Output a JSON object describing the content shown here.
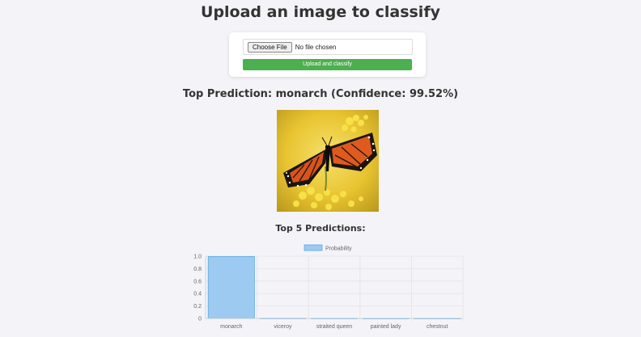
{
  "page": {
    "title": "Upload an image to classify"
  },
  "upload": {
    "choose_label": "Choose File",
    "file_status": "No file chosen",
    "submit_label": "Upload and classify",
    "submit_color": "#4caf50"
  },
  "result": {
    "top_prediction": "Top Prediction: monarch (Confidence: 99.52%)",
    "image_subject": "monarch butterfly on yellow flowers"
  },
  "top5": {
    "title": "Top 5 Predictions:"
  },
  "chart_data": {
    "type": "bar",
    "categories": [
      "monarch",
      "viceroy",
      "straited queen",
      "painted lady",
      "chestnut"
    ],
    "series": [
      {
        "name": "Probability",
        "values": [
          0.9952,
          0.002,
          0.0012,
          0.0008,
          0.0005
        ]
      }
    ],
    "yticks": [
      0,
      0.2,
      0.4,
      0.6,
      0.8,
      1.0
    ],
    "ylim": [
      0,
      1.0
    ],
    "legend": "top-center",
    "grid": true,
    "bar_color": "#9ccaf0",
    "bar_border": "#5aa9e6"
  }
}
